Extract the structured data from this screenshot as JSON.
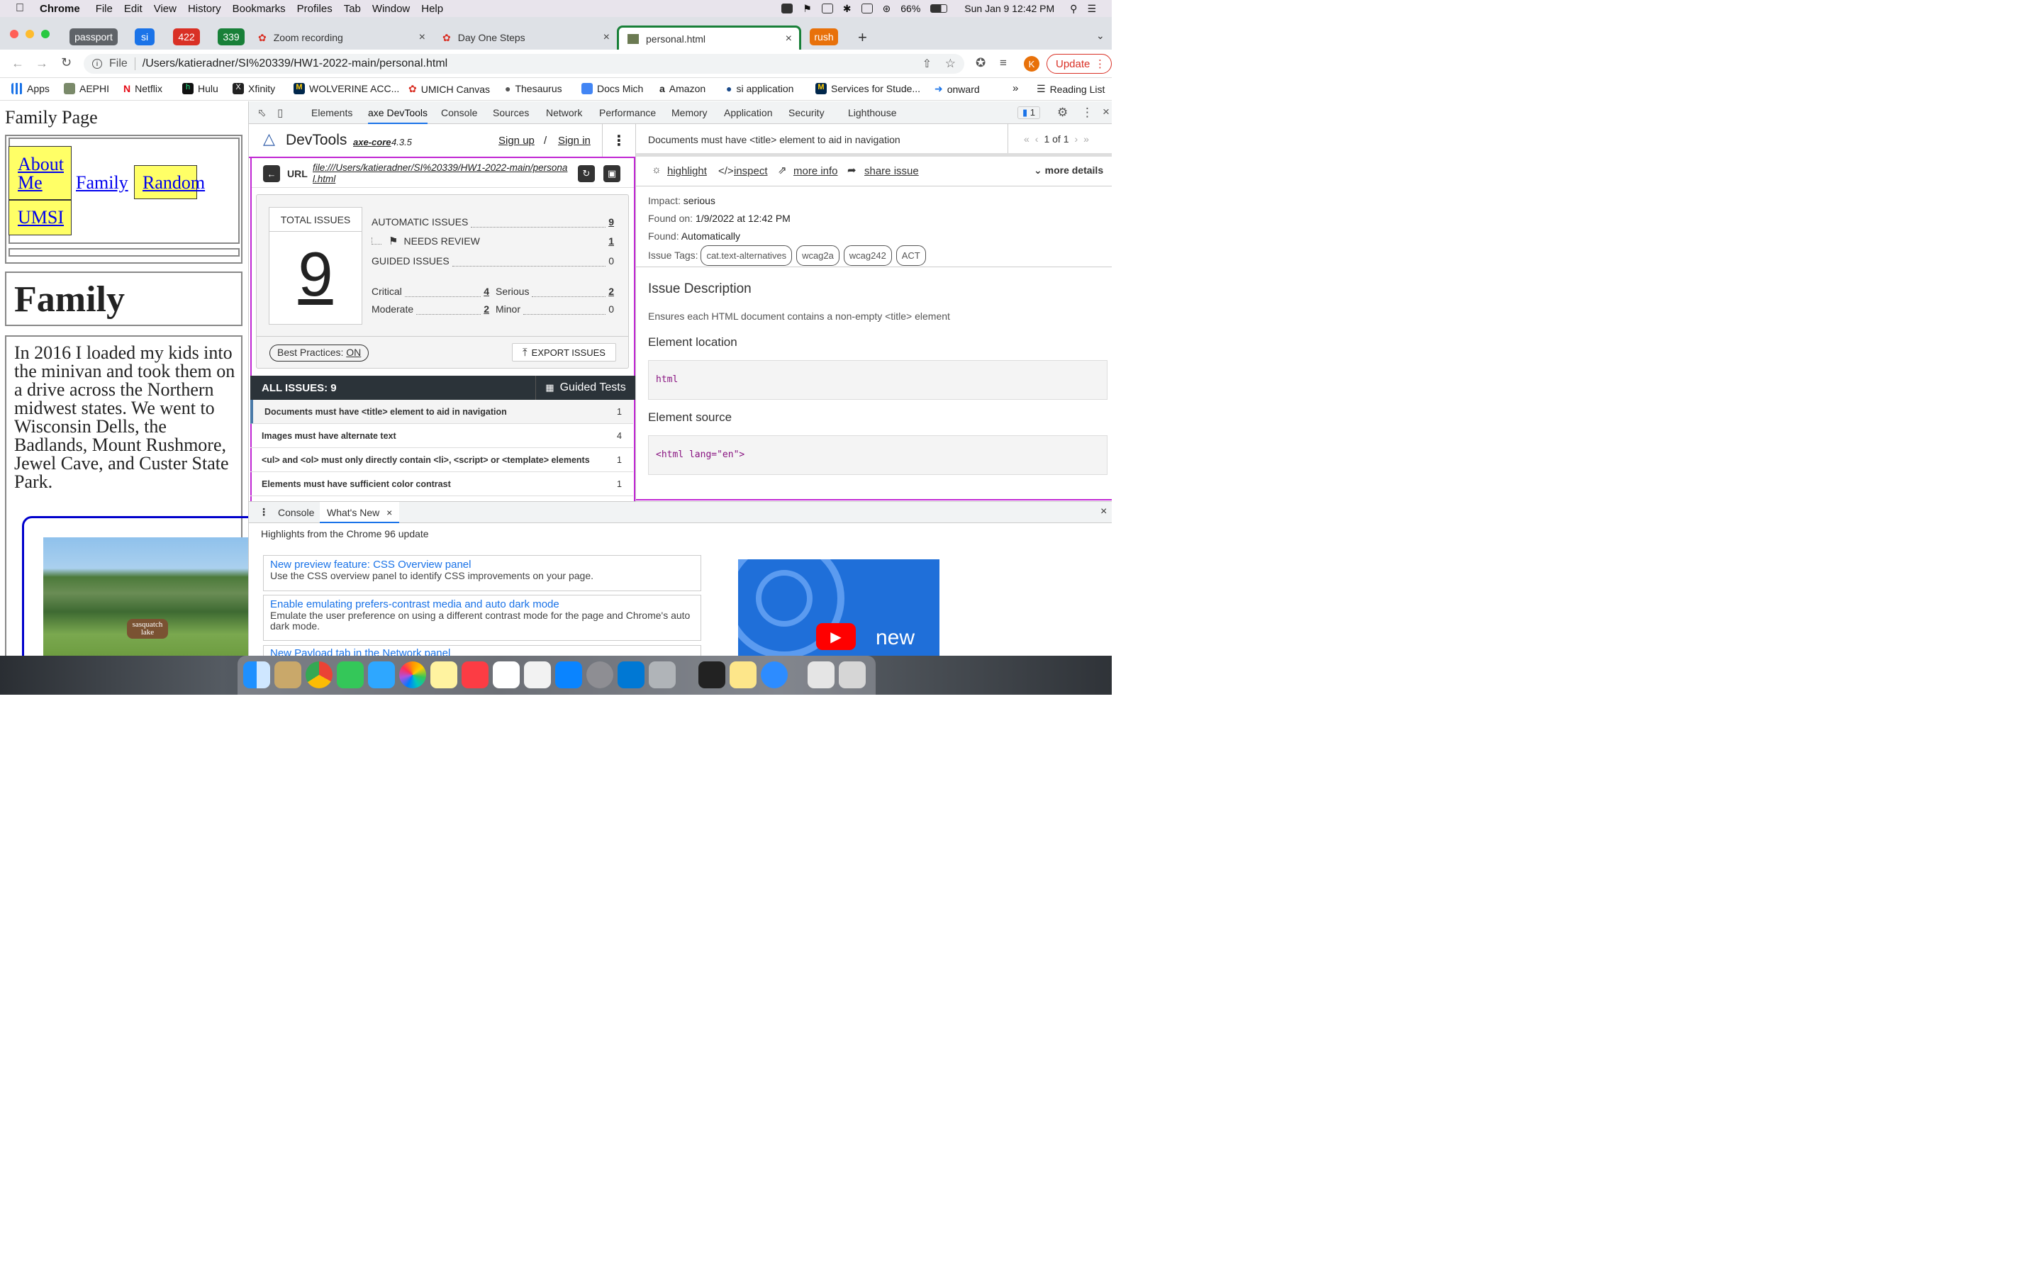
{
  "menubar": {
    "app": "Chrome",
    "items": [
      "File",
      "Edit",
      "View",
      "History",
      "Bookmarks",
      "Profiles",
      "Tab",
      "Window",
      "Help"
    ],
    "battery": "66%",
    "clock": "Sun Jan 9  12:42 PM"
  },
  "tabs": {
    "pills": [
      {
        "label": "passport",
        "color": "#5f6368"
      },
      {
        "label": "si",
        "color": "#1a73e8"
      },
      {
        "label": "422",
        "color": "#d93025"
      },
      {
        "label": "339",
        "color": "#188038"
      }
    ],
    "zoom": "Zoom recording",
    "dayone": "Day One Steps",
    "active": "personal.html",
    "rush": "rush"
  },
  "address": {
    "scheme": "File",
    "url": "/Users/katieradner/SI%20339/HW1-2022-main/personal.html",
    "update": "Update",
    "avatar": "K"
  },
  "bookmarks": [
    "Apps",
    "AEPHI",
    "Netflix",
    "Hulu",
    "Xfinity",
    "WOLVERINE ACC...",
    "UMICH Canvas",
    "Thesaurus",
    "Docs Mich",
    "Amazon",
    "si application",
    "Services for Stude...",
    "onward"
  ],
  "reading_list": "Reading List",
  "page": {
    "heading": "Family Page",
    "nav": [
      "About Me",
      "Family",
      "Random",
      "UMSI"
    ],
    "section_title": "Family",
    "body": "In 2016 I loaded my kids into the minivan and took them on a drive across the Northern midwest states. We went to Wisconsin Dells, the Badlands, Mount Rushmore, Jewel Cave, and Custer State Park.",
    "photo_sign": "sasquatch lake"
  },
  "devtools": {
    "tabs": [
      "Elements",
      "axe DevTools",
      "Console",
      "Sources",
      "Network",
      "Performance",
      "Memory",
      "Application",
      "Security",
      "Lighthouse"
    ],
    "badge": "1",
    "axe": {
      "brand": "DevTools",
      "core": "axe-core",
      "version": "4.3.5",
      "signup": "Sign up",
      "sep": "/",
      "signin": "Sign in",
      "url_label": "URL",
      "url": "file:///Users/katieradner/SI%20339/HW1-2022-main/personal.html",
      "total_label": "TOTAL ISSUES",
      "total": "9",
      "automatic_label": "AUTOMATIC ISSUES",
      "automatic": "9",
      "review_label": "NEEDS REVIEW",
      "review": "1",
      "guided_label": "GUIDED ISSUES",
      "guided": "0",
      "critical_label": "Critical",
      "critical": "4",
      "serious_label": "Serious",
      "serious": "2",
      "moderate_label": "Moderate",
      "moderate": "2",
      "minor_label": "Minor",
      "minor": "0",
      "bp_label": "Best Practices:",
      "bp_value": "ON",
      "export": "EXPORT ISSUES",
      "all_issues": "ALL ISSUES: 9",
      "guided_tests": "Guided Tests",
      "issues": [
        {
          "text": "Documents must have <title> element to aid in navigation",
          "count": "1"
        },
        {
          "text": "Images must have alternate text",
          "count": "4"
        },
        {
          "text": "<ul> and <ol> must only directly contain <li>, <script> or <template> elements",
          "count": "1"
        },
        {
          "text": "Elements must have sufficient color contrast",
          "count": "1"
        }
      ]
    },
    "detail": {
      "title": "Documents must have <title> element to aid in navigation",
      "pager": "1 of 1",
      "highlight": "highlight",
      "inspect": "inspect",
      "more_info": "more info",
      "share": "share issue",
      "more_details": "more details",
      "impact_label": "Impact:",
      "impact": "serious",
      "found_on_label": "Found on:",
      "found_on": "1/9/2022 at 12:42 PM",
      "found_label": "Found:",
      "found": "Automatically",
      "tags_label": "Issue Tags:",
      "tags": [
        "cat.text-alternatives",
        "wcag2a",
        "wcag242",
        "ACT"
      ],
      "desc_title": "Issue Description",
      "desc": "Ensures each HTML document contains a non-empty <title> element",
      "loc_title": "Element location",
      "loc": "html",
      "src_title": "Element source",
      "src": "<html lang=\"en\">"
    },
    "drawer": {
      "tabs": [
        "Console",
        "What's New"
      ],
      "highlights": "Highlights from the Chrome 96 update",
      "cards": [
        {
          "title": "New preview feature: CSS Overview panel",
          "desc": "Use the CSS overview panel to identify CSS improvements on your page."
        },
        {
          "title": "Enable emulating prefers-contrast media and auto dark mode",
          "desc": "Emulate the user preference on using a different contrast mode for the page and Chrome's auto dark mode."
        },
        {
          "title": "New Payload tab in the Network panel",
          "desc": ""
        }
      ],
      "video_text": "new"
    }
  }
}
